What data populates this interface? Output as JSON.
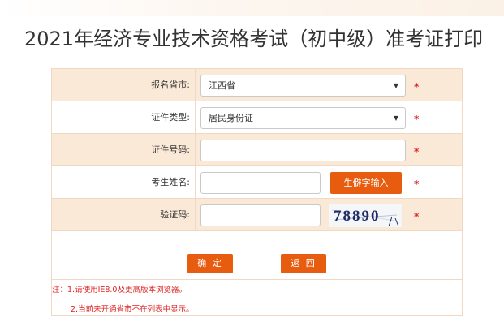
{
  "page": {
    "title": "2021年经济专业技术资格考试（初中级）准考证打印"
  },
  "form": {
    "province": {
      "label": "报名省市:",
      "value": "江西省"
    },
    "id_type": {
      "label": "证件类型:",
      "value": "居民身份证"
    },
    "id_number": {
      "label": "证件号码:",
      "value": ""
    },
    "name": {
      "label": "考生姓名:",
      "value": "",
      "rare_char_button": "生僻字输入"
    },
    "captcha": {
      "label": "验证码:",
      "value": "",
      "image_text": "78890"
    },
    "required_mark": "*"
  },
  "buttons": {
    "confirm": "确 定",
    "back": "返 回"
  },
  "notes": {
    "note1": "注：1.请使用IE8.0及更高版本浏览器。",
    "note2": "2.当前未开通省市不在列表中显示。"
  },
  "colors": {
    "accent": "#e85c10",
    "row_bg": "#fbe9d8",
    "border": "#f0d9c4",
    "required": "#e02020"
  }
}
